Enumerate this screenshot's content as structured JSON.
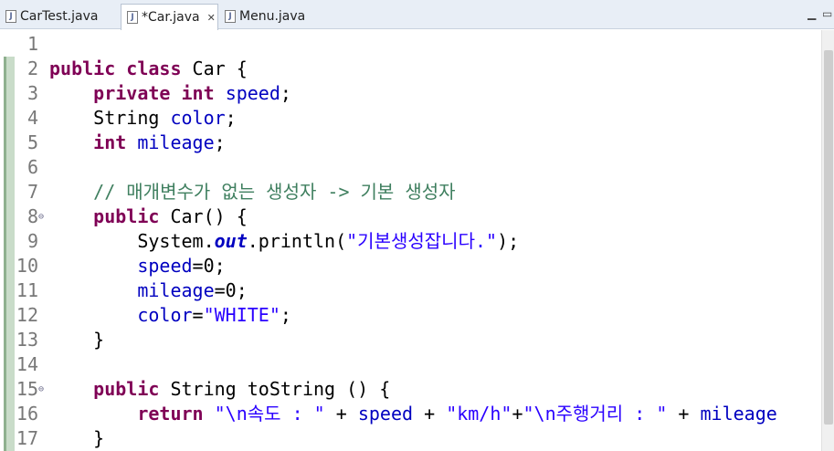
{
  "tabs": [
    {
      "label": "CarTest.java",
      "active": false
    },
    {
      "label": "*Car.java",
      "active": true
    },
    {
      "label": "Menu.java",
      "active": false
    }
  ],
  "icons": {
    "file_icon": "java-file-icon",
    "close_icon": "close-icon",
    "minimize_icon": "minimize-icon",
    "maximize_icon": "maximize-icon"
  },
  "window_controls": {
    "minimize": "▭",
    "maximize": "▭"
  },
  "editor": {
    "lines": [
      {
        "no": "1",
        "tokens": []
      },
      {
        "no": "2",
        "tokens": [
          [
            "kw",
            "public"
          ],
          [
            "t",
            " "
          ],
          [
            "kw",
            "class"
          ],
          [
            "t",
            " Car {"
          ]
        ]
      },
      {
        "no": "3",
        "tokens": [
          [
            "t",
            "    "
          ],
          [
            "kw",
            "private"
          ],
          [
            "t",
            " "
          ],
          [
            "kw",
            "int"
          ],
          [
            "t",
            " "
          ],
          [
            "fld",
            "speed"
          ],
          [
            "t",
            ";"
          ]
        ]
      },
      {
        "no": "4",
        "tokens": [
          [
            "t",
            "    String "
          ],
          [
            "fld",
            "color"
          ],
          [
            "t",
            ";"
          ]
        ]
      },
      {
        "no": "5",
        "tokens": [
          [
            "t",
            "    "
          ],
          [
            "kw",
            "int"
          ],
          [
            "t",
            " "
          ],
          [
            "fld",
            "mileage"
          ],
          [
            "t",
            ";"
          ]
        ]
      },
      {
        "no": "6",
        "tokens": []
      },
      {
        "no": "7",
        "tokens": [
          [
            "cmt",
            "    // 매개변수가 없는 생성자 -> 기본 생성자"
          ]
        ]
      },
      {
        "no": "8",
        "fold": "⊖",
        "tokens": [
          [
            "t",
            "    "
          ],
          [
            "kw",
            "public"
          ],
          [
            "t",
            " Car() {"
          ]
        ]
      },
      {
        "no": "9",
        "tokens": [
          [
            "t",
            "        System."
          ],
          [
            "sfld",
            "out"
          ],
          [
            "t",
            ".println("
          ],
          [
            "str",
            "\"기본생성잡니다.\""
          ],
          [
            "t",
            ");"
          ]
        ]
      },
      {
        "no": "10",
        "tokens": [
          [
            "t",
            "        "
          ],
          [
            "fld",
            "speed"
          ],
          [
            "t",
            "=0;"
          ]
        ]
      },
      {
        "no": "11",
        "tokens": [
          [
            "t",
            "        "
          ],
          [
            "fld",
            "mileage"
          ],
          [
            "t",
            "=0;"
          ]
        ]
      },
      {
        "no": "12",
        "tokens": [
          [
            "t",
            "        "
          ],
          [
            "fld",
            "color"
          ],
          [
            "t",
            "="
          ],
          [
            "str",
            "\"WHITE\""
          ],
          [
            "t",
            ";"
          ]
        ]
      },
      {
        "no": "13",
        "tokens": [
          [
            "t",
            "    }"
          ]
        ]
      },
      {
        "no": "14",
        "tokens": []
      },
      {
        "no": "15",
        "fold": "⊖",
        "tokens": [
          [
            "t",
            "    "
          ],
          [
            "kw",
            "public"
          ],
          [
            "t",
            " String toString () {"
          ]
        ]
      },
      {
        "no": "16",
        "tokens": [
          [
            "t",
            "        "
          ],
          [
            "kw",
            "return"
          ],
          [
            "t",
            " "
          ],
          [
            "str",
            "\"\\n속도 : \""
          ],
          [
            "t",
            " + "
          ],
          [
            "fld",
            "speed"
          ],
          [
            "t",
            " + "
          ],
          [
            "str",
            "\"km/h\""
          ],
          [
            "t",
            "+"
          ],
          [
            "str",
            "\"\\n주행거리 : \""
          ],
          [
            "t",
            " + "
          ],
          [
            "fld",
            "mileage"
          ]
        ]
      },
      {
        "no": "17",
        "tokens": [
          [
            "t",
            "    }"
          ]
        ]
      }
    ]
  }
}
